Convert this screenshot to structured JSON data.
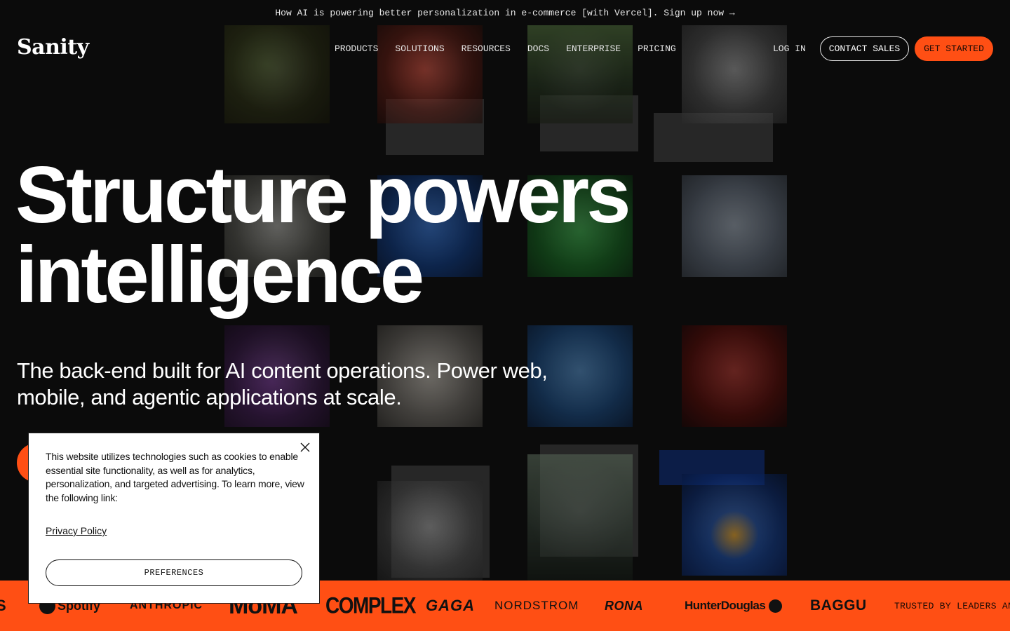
{
  "announcement": {
    "text": "How AI is powering better personalization in e-commerce [with Vercel]. Sign up now →"
  },
  "header": {
    "logo": "Sanity",
    "nav": [
      {
        "label": "PRODUCTS"
      },
      {
        "label": "SOLUTIONS"
      },
      {
        "label": "RESOURCES"
      },
      {
        "label": "DOCS"
      },
      {
        "label": "ENTERPRISE"
      },
      {
        "label": "PRICING"
      }
    ],
    "login_label": "LOG IN",
    "contact_label": "CONTACT SALES",
    "get_started_label": "GET STARTED"
  },
  "hero": {
    "title_line1": "Structure powers",
    "title_line2": "intelligence",
    "subtitle": "The back-end built for AI content operations. Power web, mobile, and agentic applications at scale."
  },
  "cookie_banner": {
    "text": "This website utilizes technologies such as cookies to enable essential site functionality, as well as for analytics, personalization, and targeted advertising. To learn more, view the following link:",
    "link_label": "Privacy Policy",
    "preferences_label": "PREFERENCES",
    "close_icon": "close-icon"
  },
  "logo_strip": {
    "brands": [
      "S",
      "Spotify",
      "ANTHROPIC",
      "MoMA",
      "COMPLEX",
      "GAGA",
      "NORDSTROM",
      "RONA",
      "HunterDouglas",
      "BAGGU"
    ],
    "trusted_text": "TRUSTED BY LEADERS AN"
  },
  "colors": {
    "accent": "#ff4f14",
    "background": "#0b0b0b",
    "text": "#ffffff"
  }
}
